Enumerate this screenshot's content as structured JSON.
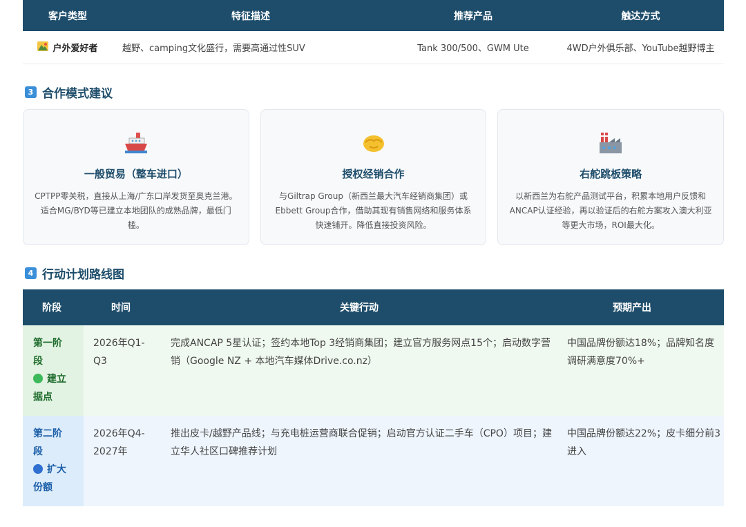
{
  "customer_table": {
    "headers": [
      "客户类型",
      "特征描述",
      "推荐产品",
      "触达方式"
    ],
    "rows": [
      {
        "type": "户外爱好者",
        "icon": "mountain-icon",
        "description": "越野、camping文化盛行，需要高通过性SUV",
        "products": "Tank 300/500、GWM Ute",
        "channel": "4WD户外俱乐部、YouTube越野博主"
      }
    ]
  },
  "section3": {
    "number": "3",
    "title": "合作模式建议"
  },
  "cards": [
    {
      "icon": "ship-icon",
      "title": "一般贸易（整车进口）",
      "desc": "CPTPP零关税，直接从上海/广东口岸发货至奥克兰港。适合MG/BYD等已建立本地团队的成熟品牌，最低门槛。"
    },
    {
      "icon": "handshake-icon",
      "title": "授权经销合作",
      "desc": "与Giltrap Group（新西兰最大汽车经销商集团）或Ebbett Group合作，借助其现有销售网络和服务体系快速铺开。降低直接投资风险。"
    },
    {
      "icon": "factory-icon",
      "title": "右舵跳板策略",
      "desc": "以新西兰为右舵产品测试平台，积累本地用户反馈和ANCAP认证经验，再以验证后的右舵方案攻入澳大利亚等更大市场，ROI最大化。"
    }
  ],
  "section4": {
    "number": "4",
    "title": "行动计划路线图"
  },
  "roadmap": {
    "headers": [
      "阶段",
      "时间",
      "关键行动",
      "预期产出"
    ],
    "rows": [
      {
        "stage_line1": "第一阶",
        "stage_line2": "段",
        "stage_name_line1": "建立",
        "stage_name_line2": "据点",
        "dot_color": "#3cb95a",
        "time_line1": "2026年Q1-",
        "time_line2": "Q3",
        "actions": "完成ANCAP 5星认证；签约本地Top 3经销商集团；建立官方服务网点15个；启动数字营销（Google NZ + 本地汽车媒体Drive.co.nz）",
        "output": "中国品牌份额达18%；品牌知名度调研满意度70%+"
      },
      {
        "stage_line1": "第二阶",
        "stage_line2": "段",
        "stage_name_line1": "扩大",
        "stage_name_line2": "份额",
        "dot_color": "#2f6fd0",
        "time_line1": "2026年Q4-",
        "time_line2": "2027年",
        "actions": "推出皮卡/越野产品线；与充电桩运营商联合促销；启动官方认证二手车（CPO）项目；建立华人社区口碑推荐计划",
        "output": "中国品牌份额达22%；皮卡细分前3进入"
      }
    ]
  }
}
